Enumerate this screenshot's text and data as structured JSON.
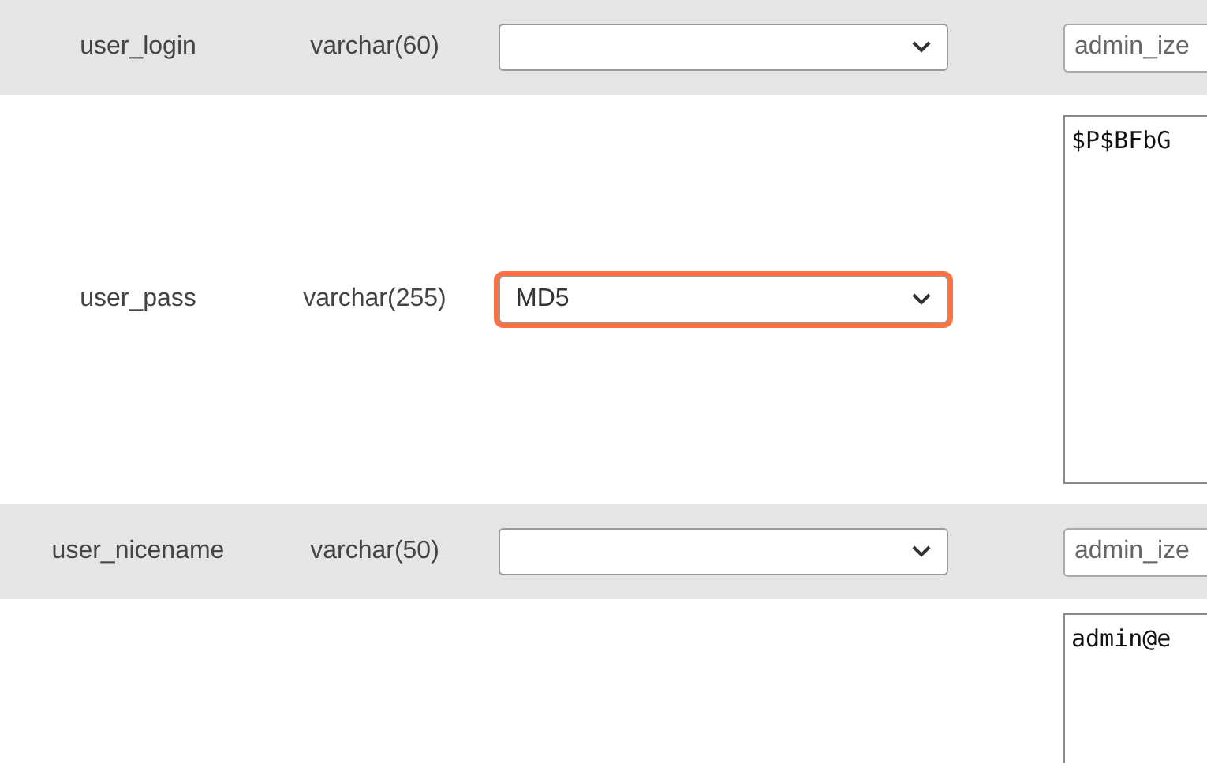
{
  "rows": [
    {
      "column": "user_login",
      "type": "varchar(60)",
      "function": {
        "focused": false
      },
      "field": {
        "kind": "input",
        "value": "admin_ize"
      }
    },
    {
      "column": "user_pass",
      "type": "varchar(255)",
      "function": {
        "value": "MD5",
        "focused": true
      },
      "field": {
        "kind": "textarea",
        "value": "$P$BFbG"
      }
    },
    {
      "column": "user_nicename",
      "type": "varchar(50)",
      "function": {
        "focused": false
      },
      "field": {
        "kind": "input",
        "value": "admin_ize"
      }
    },
    {
      "field": {
        "kind": "textarea",
        "value": "admin@e"
      }
    }
  ]
}
